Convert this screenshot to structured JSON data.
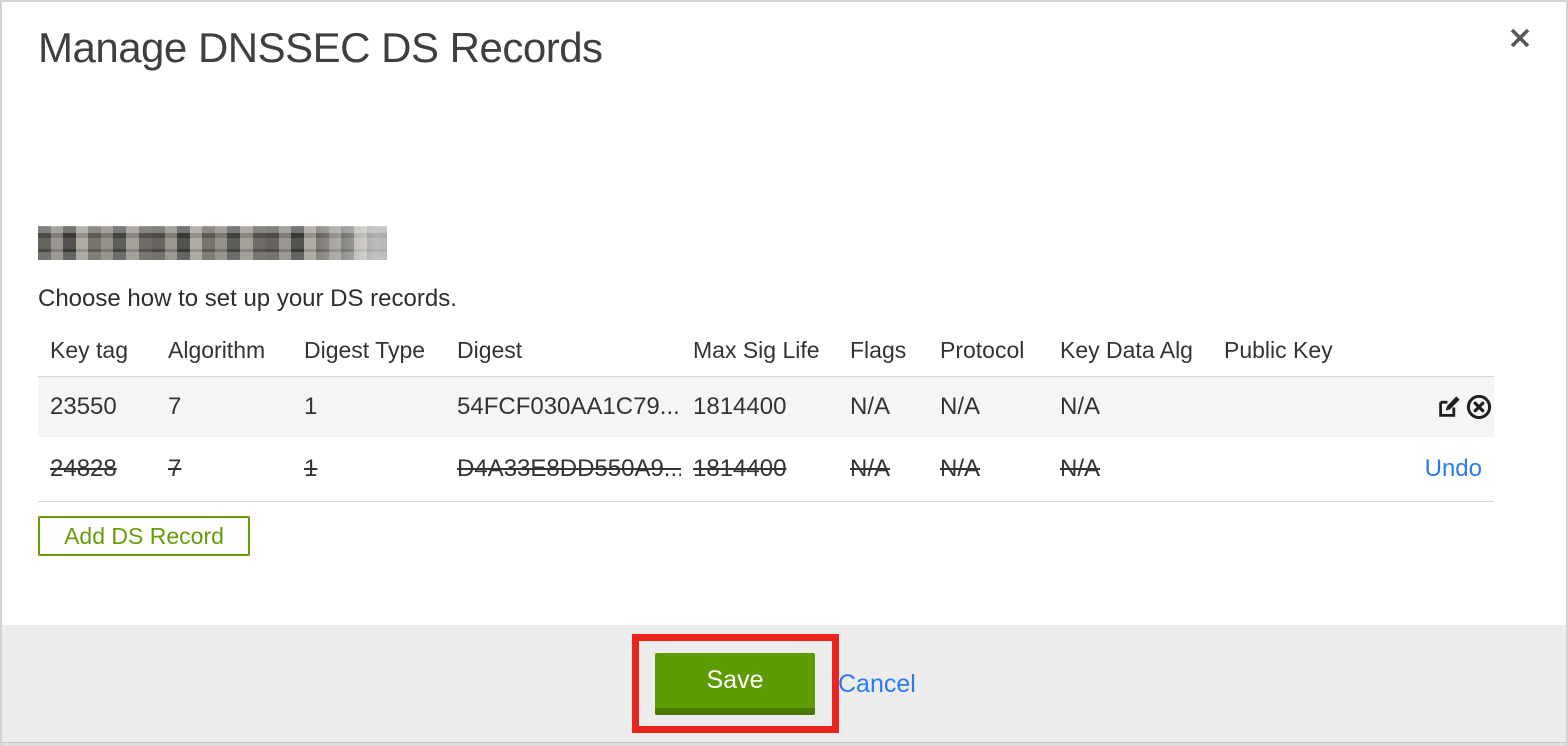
{
  "modal": {
    "title": "Manage DNSSEC DS Records",
    "instruction": "Choose how to set up your DS records.",
    "domain_redacted": true
  },
  "table": {
    "columns": [
      "Key tag",
      "Algorithm",
      "Digest Type",
      "Digest",
      "Max Sig Life",
      "Flags",
      "Protocol",
      "Key Data Alg",
      "Public Key"
    ],
    "rows": [
      {
        "key_tag": "23550",
        "algorithm": "7",
        "digest_type": "1",
        "digest": "54FCF030AA1C79...",
        "max_sig_life": "1814400",
        "flags": "N/A",
        "protocol": "N/A",
        "key_data_alg": "N/A",
        "public_key": "",
        "state": "active"
      },
      {
        "key_tag": "24828",
        "algorithm": "7",
        "digest_type": "1",
        "digest": "D4A33E8DD550A9...",
        "max_sig_life": "1814400",
        "flags": "N/A",
        "protocol": "N/A",
        "key_data_alg": "N/A",
        "public_key": "",
        "state": "pending-delete",
        "undo_label": "Undo"
      }
    ]
  },
  "buttons": {
    "add_ds_record": "Add DS Record",
    "save": "Save",
    "cancel": "Cancel"
  },
  "icons": {
    "close": "close-x",
    "edit": "edit-pencil-square",
    "delete": "circled-x"
  },
  "colors": {
    "save_green": "#5f9b03",
    "save_green_dark_edge": "#4b7a02",
    "add_button_green": "#699c0a",
    "link_blue": "#2b7ce9",
    "annotation_red": "#ea241c",
    "row_alt_bg": "#f5f5f5",
    "footer_bg": "#ececec"
  }
}
